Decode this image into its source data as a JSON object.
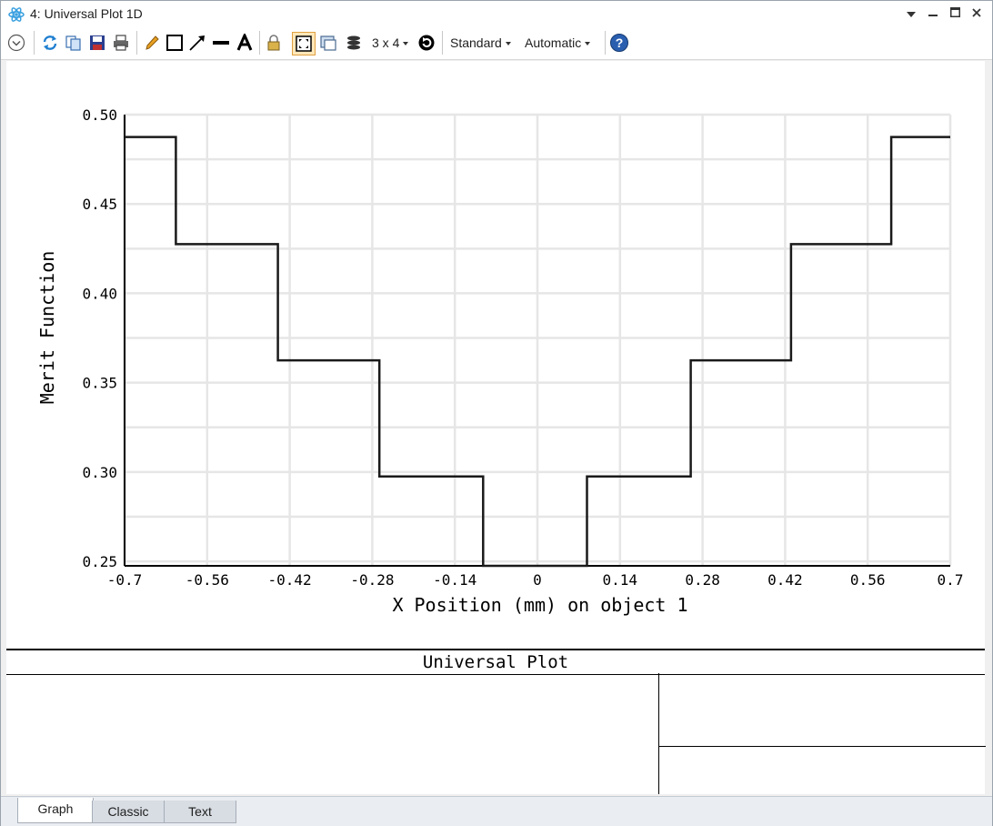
{
  "window": {
    "title": "4: Universal Plot 1D",
    "controls": [
      "dropdown-arrow",
      "minimize",
      "maximize",
      "close"
    ]
  },
  "toolbar": {
    "layout_label": "3 x 4",
    "standard_label": "Standard",
    "automatic_label": "Automatic",
    "icons": [
      "collapse-icon",
      "refresh-icon",
      "copy-icon",
      "save-icon",
      "print-icon",
      "pencil-icon",
      "rectangle-icon",
      "arrow-icon",
      "line-icon",
      "text-icon",
      "lock-icon",
      "fit-icon",
      "window-icon",
      "layers-icon",
      "layout-grid",
      "rotate-icon",
      "standard-dropdown",
      "automatic-dropdown",
      "help-icon"
    ]
  },
  "chart_data": {
    "type": "line",
    "xlabel": "X Position (mm) on object 1",
    "ylabel": "Merit Function",
    "xlim": [
      -0.7,
      0.7
    ],
    "ylim": [
      0.2475,
      0.5
    ],
    "xticks": [
      "-0.7",
      "-0.56",
      "-0.42",
      "-0.28",
      "-0.14",
      "0",
      "0.14",
      "0.28",
      "0.42",
      "0.56",
      "0.7"
    ],
    "yticks": [
      "0.50",
      "0.45",
      "0.40",
      "0.35",
      "0.30",
      "0.25"
    ],
    "grid": true,
    "series": [
      {
        "x": [
          -0.7,
          -0.613,
          -0.613,
          -0.44,
          -0.44,
          -0.268,
          -0.268,
          -0.092,
          -0.092,
          0.084,
          0.084,
          0.26,
          0.26,
          0.43,
          0.43,
          0.6,
          0.6,
          0.7
        ],
        "y": [
          0.4875,
          0.4875,
          0.4275,
          0.4275,
          0.3625,
          0.3625,
          0.2975,
          0.2975,
          0.2475,
          0.2475,
          0.2975,
          0.2975,
          0.3625,
          0.3625,
          0.4275,
          0.4275,
          0.4875,
          0.4875
        ]
      }
    ],
    "color": "#1a1a1a"
  },
  "footer": {
    "title": "Universal Plot"
  },
  "tabs": [
    {
      "label": "Graph",
      "active": true
    },
    {
      "label": "Classic",
      "active": false
    },
    {
      "label": "Text",
      "active": false
    }
  ]
}
